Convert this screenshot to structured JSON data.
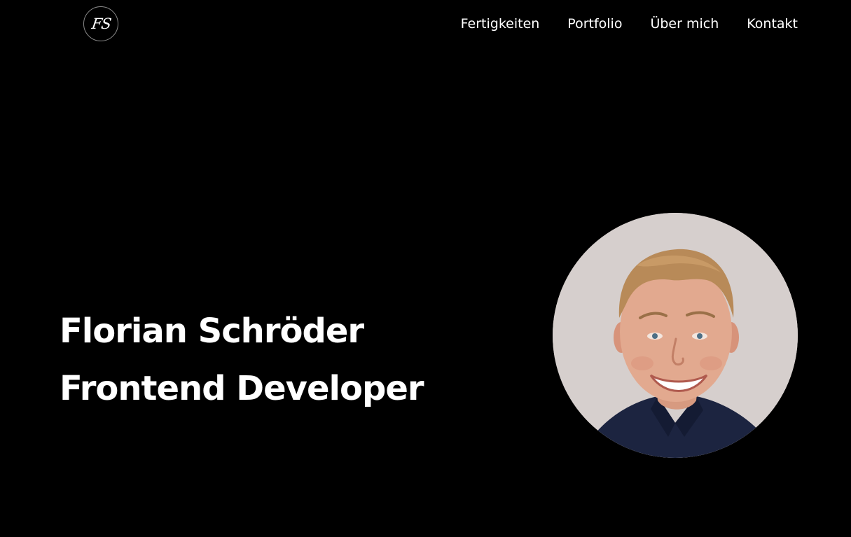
{
  "header": {
    "logo_text": "FS",
    "nav": [
      {
        "label": "Fertigkeiten"
      },
      {
        "label": "Portfolio"
      },
      {
        "label": "Über mich"
      },
      {
        "label": "Kontakt"
      }
    ]
  },
  "hero": {
    "name": "Florian Schröder",
    "role": "Frontend Developer"
  },
  "colors": {
    "background": "#000000",
    "text": "#ffffff",
    "portrait_background": "#d4cdcb"
  }
}
